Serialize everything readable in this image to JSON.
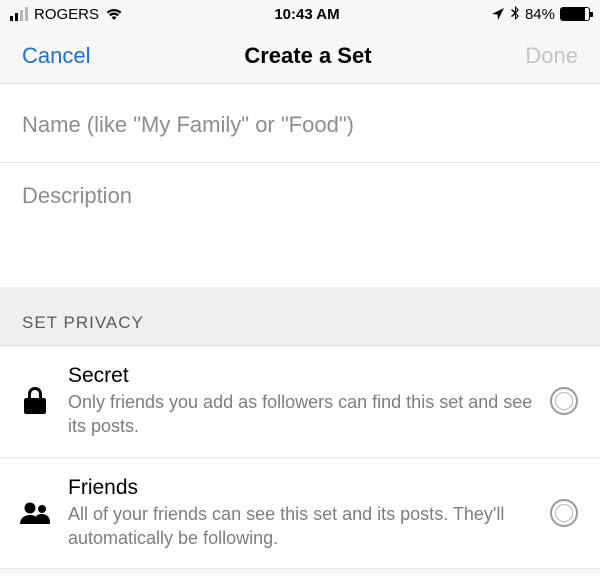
{
  "status_bar": {
    "carrier": "ROGERS",
    "time": "10:43 AM",
    "battery_percent": "84%"
  },
  "nav": {
    "cancel": "Cancel",
    "title": "Create a Set",
    "done": "Done"
  },
  "inputs": {
    "name_placeholder": "Name (like \"My Family\" or \"Food\")",
    "description_placeholder": "Description"
  },
  "privacy": {
    "header": "SET PRIVACY",
    "options": [
      {
        "title": "Secret",
        "subtitle": "Only friends you add as followers can find this set and see its posts."
      },
      {
        "title": "Friends",
        "subtitle": "All of your friends can see this set and its posts. They'll automatically be following."
      }
    ]
  }
}
